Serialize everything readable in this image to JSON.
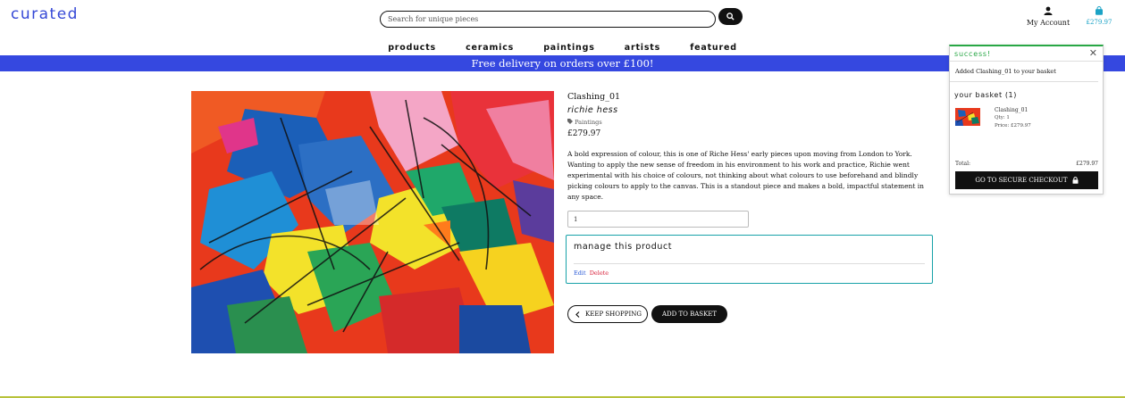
{
  "header": {
    "logo": "curated",
    "search_placeholder": "Search for unique pieces",
    "account_label": "My Account",
    "cart_total": "£279.97"
  },
  "nav": {
    "items": [
      "products",
      "ceramics",
      "paintings",
      "artists",
      "featured"
    ]
  },
  "banner": {
    "text": "Free delivery on orders over £100!"
  },
  "product": {
    "name": "Clashing_01",
    "artist": "richie hess",
    "category": "Paintings",
    "price": "£279.97",
    "description": "A bold expression of colour, this is one of Riche Hess' early pieces upon moving from London to York. Wanting to apply the new sense of freedom in his environment to his work and practice, Richie went experimental with his choice of colours, not thinking about what colours to use beforehand and blindly picking colours to apply to the canvas. This is a standout piece and makes a bold, impactful statement in any space.",
    "quantity": "1"
  },
  "manage": {
    "title": "manage this product",
    "edit": "Edit",
    "delete": "Delete"
  },
  "buttons": {
    "keep_shopping": "KEEP SHOPPING",
    "add_to_basket": "ADD TO BASKET"
  },
  "toast": {
    "title": "success!",
    "message": "Added Clashing_01 to your basket",
    "basket_label": "your basket (1)",
    "item_name": "Clashing_01",
    "item_qty": "Qty: 1",
    "item_price": "Price: £279.97",
    "total_label": "Total:",
    "total_value": "£279.97",
    "checkout_label": "GO TO SECURE CHECKOUT"
  },
  "colors": {
    "brand": "#3548d6",
    "banner": "#3548e0",
    "accent": "#17a2a8",
    "success": "#28a745",
    "cart": "#1ba3c6",
    "delete": "#d8203a"
  },
  "icons": [
    "search-icon",
    "user-icon",
    "shopping-bag-icon",
    "tag-icon",
    "chevron-left-icon",
    "lock-icon",
    "close-icon"
  ]
}
